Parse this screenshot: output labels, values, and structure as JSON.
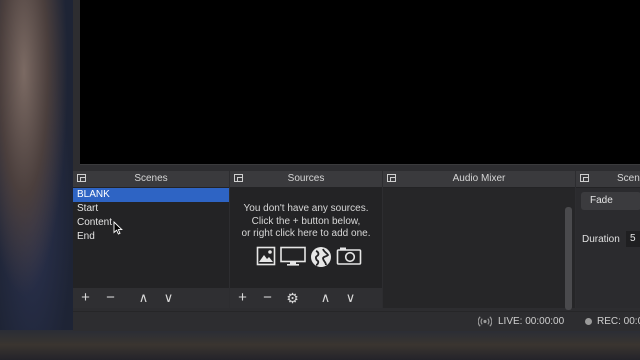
{
  "docks": {
    "scenes": {
      "title": "Scenes",
      "items": [
        "BLANK",
        "Start",
        "Content",
        "End"
      ],
      "selected_index": 0
    },
    "sources": {
      "title": "Sources",
      "empty_message": [
        "You don't have any sources.",
        "Click the + button below,",
        "or right click here to add one."
      ]
    },
    "audio_mixer": {
      "title": "Audio Mixer"
    },
    "transitions": {
      "title": "Scen",
      "selected": "Fade",
      "duration_label": "Duration",
      "duration_value": "5"
    }
  },
  "toolbar_glyphs": {
    "add": "+",
    "remove": "−",
    "up": "∧",
    "down": "∨",
    "settings": "⚙"
  },
  "status": {
    "live": "LIVE: 00:00:00",
    "rec": "REC: 00:0"
  },
  "icons": [
    "image-icon",
    "display-icon",
    "globe-icon",
    "camera-icon",
    "broadcast-icon",
    "record-dot-icon",
    "float-dock-icon",
    "cursor-icon"
  ],
  "colors": {
    "accent_selected": "#2e64c4"
  }
}
